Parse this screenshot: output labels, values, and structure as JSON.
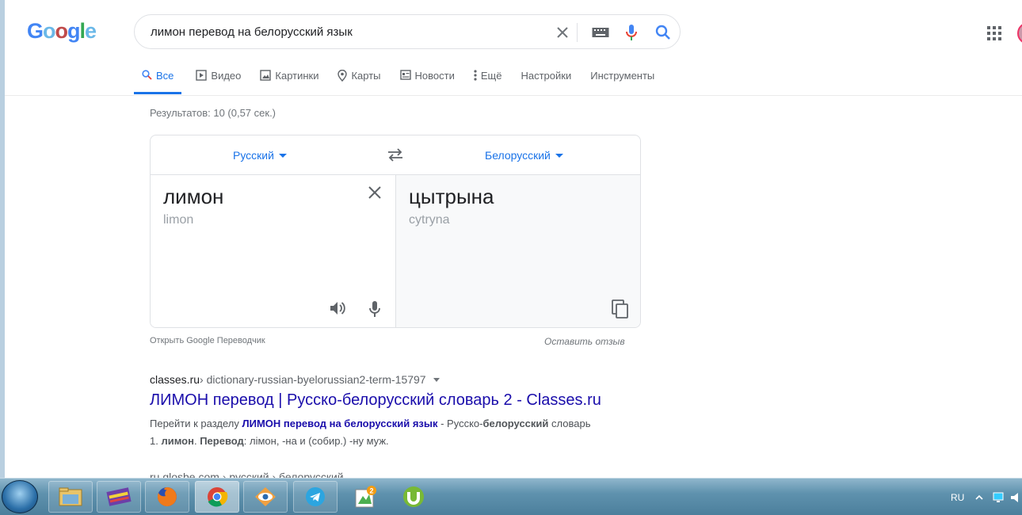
{
  "logo": {
    "text": "Google"
  },
  "search": {
    "query": "лимон перевод на белорусский язык"
  },
  "tabs": [
    {
      "label": "Все",
      "icon": "search-icon",
      "active": true
    },
    {
      "label": "Видео",
      "icon": "video-icon"
    },
    {
      "label": "Картинки",
      "icon": "image-icon"
    },
    {
      "label": "Карты",
      "icon": "map-pin-icon"
    },
    {
      "label": "Новости",
      "icon": "news-icon"
    },
    {
      "label": "Ещё",
      "icon": "more-vert-icon"
    },
    {
      "label": "Настройки"
    },
    {
      "label": "Инструменты"
    }
  ],
  "stats": "Результатов: 10 (0,57 сек.)",
  "translator": {
    "source_lang": "Русский",
    "target_lang": "Белорусский",
    "source_word": "лимон",
    "source_translit": "limon",
    "target_word": "цытрына",
    "target_translit": "cytryna",
    "open_link": "Открыть Google Переводчик",
    "feedback": "Оставить отзыв"
  },
  "result1": {
    "domain": "classes.ru",
    "path": " › dictionary-russian-byelorussian2-term-15797",
    "title": "ЛИМОН перевод | Русско-белорусский словарь 2 - Classes.ru",
    "snippet_prefix": "Перейти к разделу ",
    "snippet_link": "ЛИМОН перевод на белорусский язык",
    "snippet_mid": " - Русско-",
    "snippet_bold": "белорусский",
    "snippet_tail": " словарь",
    "snippet_line2_num": "1. ",
    "snippet_line2_b1": "лимон",
    "snippet_line2_sep": ". ",
    "snippet_line2_b2": "Перевод",
    "snippet_line2_rest": ": лімон, -на и (собир.) -ну муж."
  },
  "result2": {
    "partial": "ru.glosbe.com › русский › белорусский"
  },
  "taskbar": {
    "apps": [
      "file-explorer-icon",
      "archive-icon",
      "firefox-icon",
      "chrome-icon",
      "eye-app-icon",
      "telegram-icon",
      "notes-app-icon",
      "utorrent-icon"
    ],
    "lang": "RU"
  },
  "colors": {
    "accent": "#1a73e8",
    "link": "#1a0dab",
    "taskbar": "#5f92ae"
  }
}
